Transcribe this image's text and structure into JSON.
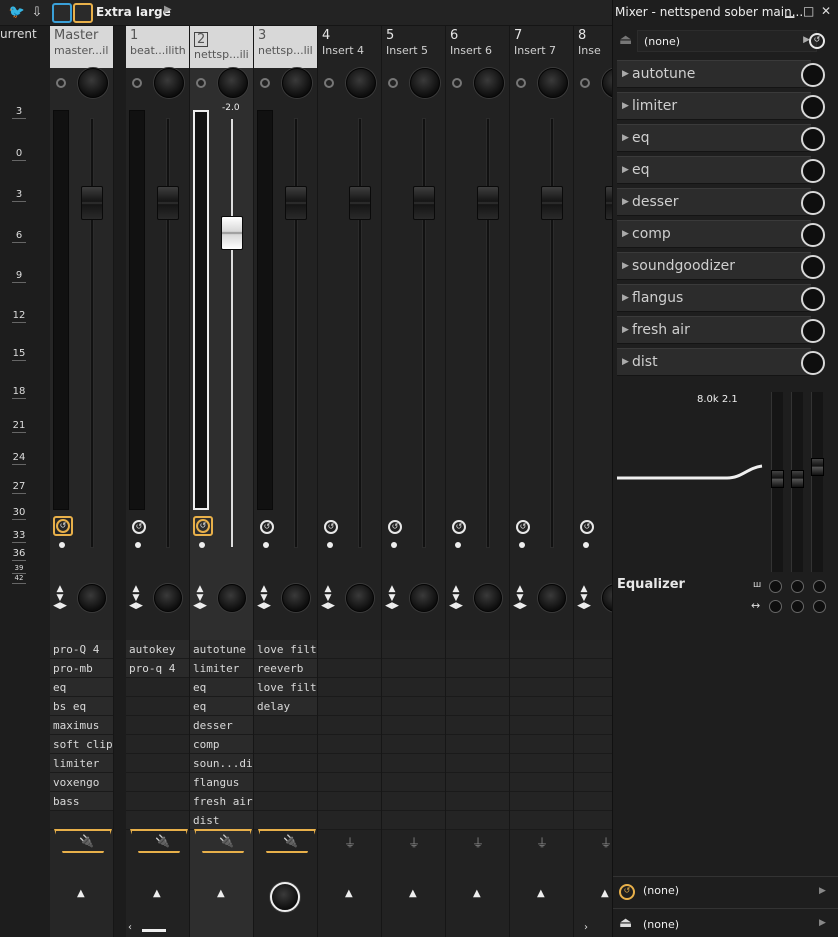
{
  "toolbar": {
    "preset_label": "Extra large"
  },
  "scale": {
    "label": "urrent",
    "ticks": [
      "3",
      "0",
      "3",
      "6",
      "9",
      "12",
      "15",
      "18",
      "21",
      "24",
      "27",
      "30",
      "33",
      "36",
      "39",
      "42"
    ]
  },
  "strips": [
    {
      "num": "Master",
      "name": "master...ilith",
      "fx": [
        "pro-Q 4",
        "pro-mb",
        "eq",
        "bs eq",
        "maximus",
        "soft clipper",
        "limiter",
        "voxengo",
        "bass"
      ]
    },
    {
      "num": "1",
      "name": "beat...ilith",
      "fx": [
        "autokey",
        "pro-q 4"
      ]
    },
    {
      "num": "2",
      "name": "nettsp...ilith",
      "fx": [
        "autotune",
        "limiter",
        "eq",
        "eq",
        "desser",
        "comp",
        "soun...dizer",
        "flangus",
        "fresh air",
        "dist"
      ],
      "pan_value": "-2.0"
    },
    {
      "num": "3",
      "name": "nettsp...lilith",
      "fx": [
        "love filter",
        "reeverb",
        "love filter",
        "delay"
      ]
    },
    {
      "num": "4",
      "name": "Insert 4",
      "fx": []
    },
    {
      "num": "5",
      "name": "Insert 5",
      "fx": []
    },
    {
      "num": "6",
      "name": "Insert 6",
      "fx": []
    },
    {
      "num": "7",
      "name": "Insert 7",
      "fx": []
    },
    {
      "num": "8",
      "name": "Inse",
      "fx": []
    }
  ],
  "panel": {
    "title": "Mixer - nettspend sober main...",
    "input_route": "(none)",
    "slots": [
      "autotune",
      "limiter",
      "eq",
      "eq",
      "desser",
      "comp",
      "soundgoodizer",
      "flangus",
      "fresh air",
      "dist"
    ],
    "eq_readout": "8.0k 2.1",
    "eq_label": "Equalizer",
    "out_time": "(none)",
    "out_route": "(none)"
  },
  "colors": {
    "accent": "#e8b04a",
    "highlight_blue": "#3aa0d8"
  }
}
